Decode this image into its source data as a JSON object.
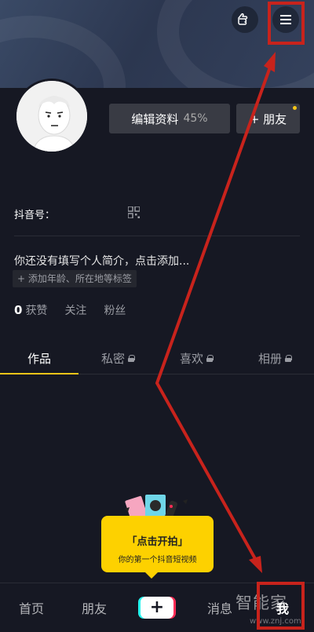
{
  "profile": {
    "edit_label": "编辑资料",
    "edit_percent": "45%",
    "friends_button": "+ 朋友",
    "douyin_id_label": "抖音号：",
    "bio_placeholder": "你还没有填写个人简介，点击添加...",
    "tag_placeholder": "+ 添加年龄、所在地等标签"
  },
  "stats": {
    "likes_count": "0",
    "likes_label": "获赞",
    "following_label": "关注",
    "followers_label": "粉丝"
  },
  "tabs": [
    {
      "label": "作品",
      "active": true
    },
    {
      "label": "私密",
      "locked": true
    },
    {
      "label": "喜欢",
      "locked": true
    },
    {
      "label": "相册",
      "locked": true
    }
  ],
  "tooltip": {
    "title": "「点击开拍」",
    "subtitle": "你的第一个抖音短视频"
  },
  "nav": {
    "home": "首页",
    "friends": "朋友",
    "create": "+",
    "messages": "消息",
    "me": "我"
  },
  "watermark": {
    "brand": "智能家",
    "url": "www.znj.com"
  },
  "icons": {
    "pointer": "hand-pointer-icon",
    "menu": "hamburger-menu-icon",
    "qr": "qr-code-icon",
    "lock": "lock-icon"
  },
  "colors": {
    "background": "#161823",
    "accent": "#f5c518",
    "tooltip": "#fdd100",
    "annotation": "#c8231c"
  }
}
